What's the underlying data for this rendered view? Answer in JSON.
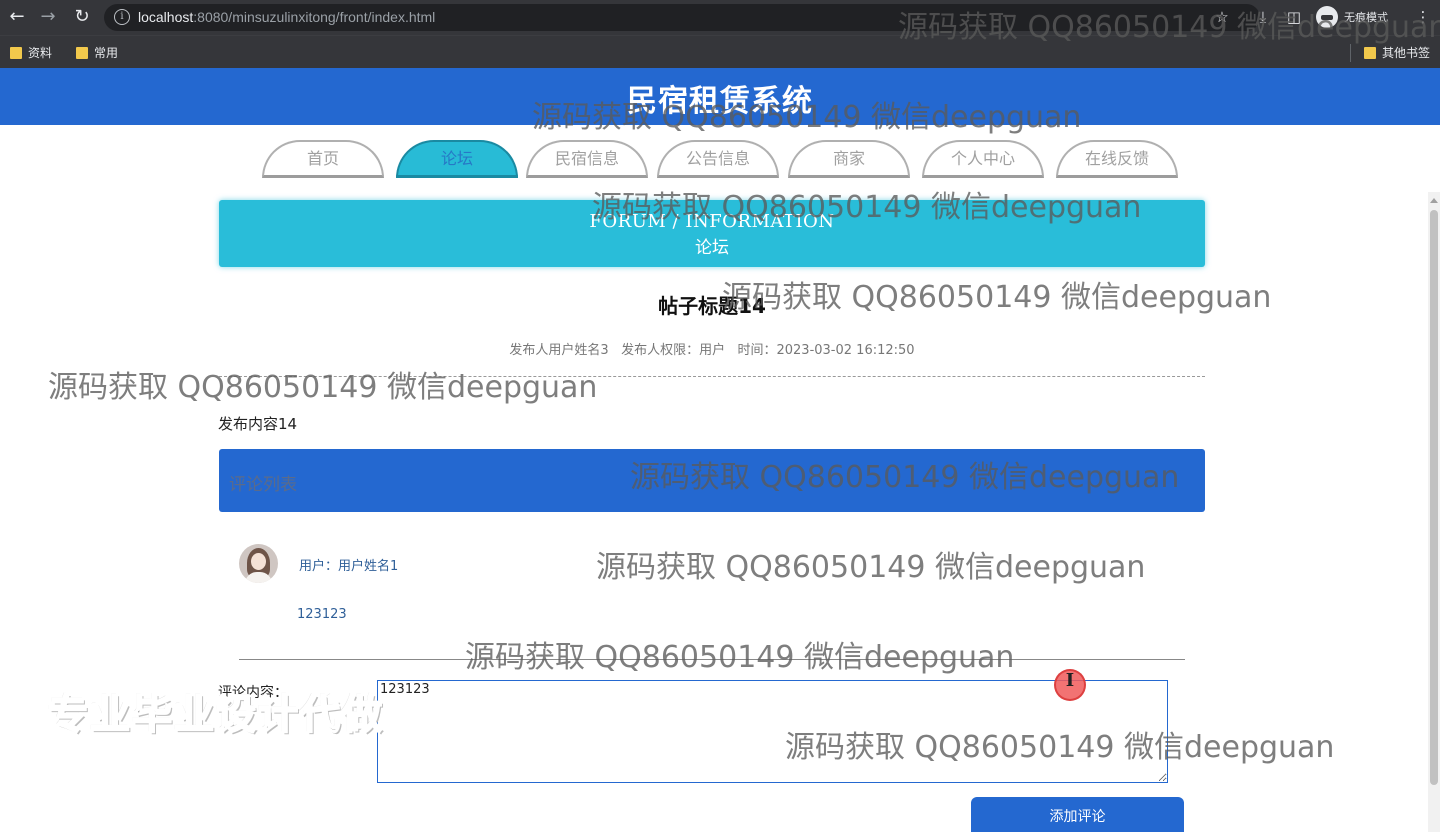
{
  "browser": {
    "url_host": "localhost",
    "url_rest": ":8080/minsuzulinxitong/front/index.html",
    "profile_label": "无痕模式",
    "bookmarks": [
      "资料",
      "常用"
    ],
    "other_bookmarks": "其他书签"
  },
  "site": {
    "title": "民宿租赁系统",
    "nav": [
      "首页",
      "论坛",
      "民宿信息",
      "公告信息",
      "商家",
      "个人中心",
      "在线反馈"
    ],
    "active_nav": "论坛"
  },
  "banner": {
    "en": "FORUM / INFORMATION",
    "cn": "论坛"
  },
  "post": {
    "title": "帖子标题14",
    "meta": "发布人用户姓名3   发布人权限：用户   时间：2023-03-02 16:12:50",
    "content": "发布内容14"
  },
  "comments": {
    "header": "评论列表",
    "items": [
      {
        "user": "用户：用户姓名1",
        "text": "123123"
      }
    ]
  },
  "form": {
    "label": "评论内容：",
    "value": "123123",
    "submit": "添加评论"
  },
  "watermarks": {
    "repeated": "源码获取 QQ86050149 微信deepguan",
    "big": "专业毕业设计代做"
  },
  "colors": {
    "brand_blue": "#2468d0",
    "banner_cyan": "#29bdd9"
  }
}
